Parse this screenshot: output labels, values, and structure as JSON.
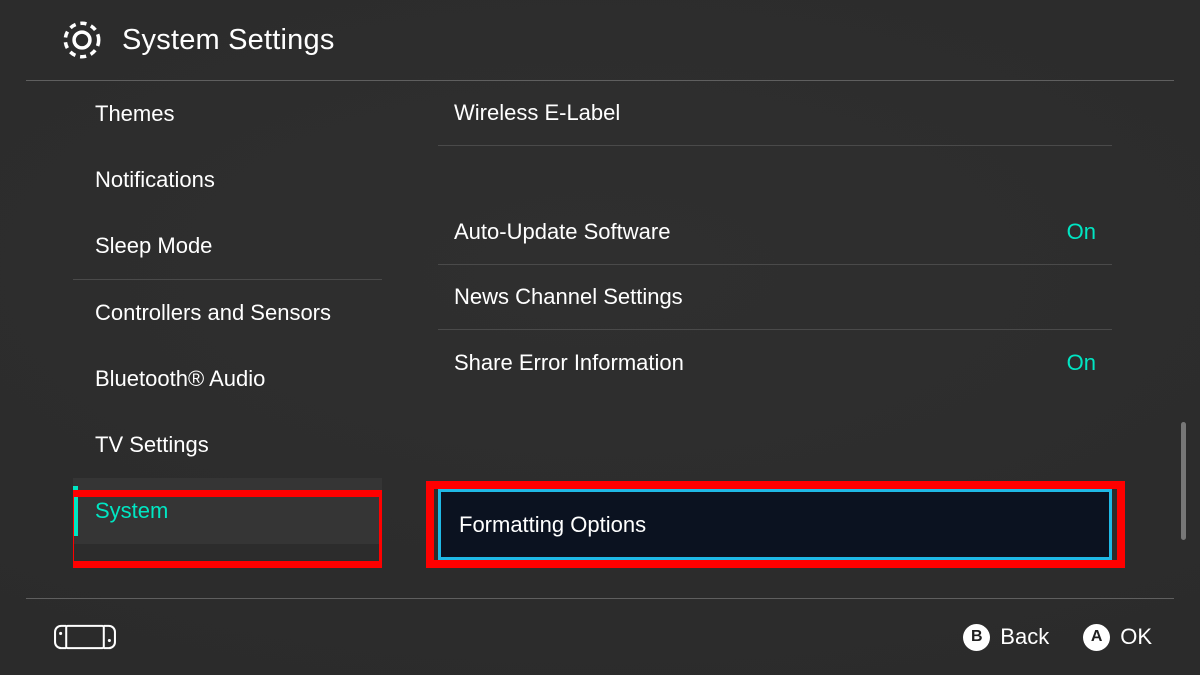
{
  "header": {
    "title": "System Settings"
  },
  "sidebar": {
    "items": [
      {
        "label": "Themes"
      },
      {
        "label": "Notifications"
      },
      {
        "label": "Sleep Mode"
      },
      {
        "label": "Controllers and Sensors"
      },
      {
        "label": "Bluetooth® Audio"
      },
      {
        "label": "TV Settings"
      },
      {
        "label": "System"
      }
    ],
    "selectedIndex": 6
  },
  "content": {
    "rows": [
      {
        "label": "Wireless E-Label",
        "value": ""
      },
      {
        "gap": true
      },
      {
        "label": "Auto-Update Software",
        "value": "On"
      },
      {
        "label": "News Channel Settings",
        "value": ""
      },
      {
        "label": "Share Error Information",
        "value": "On"
      }
    ],
    "focus": {
      "label": "Formatting Options"
    }
  },
  "footer": {
    "back": {
      "key": "B",
      "label": "Back"
    },
    "ok": {
      "key": "A",
      "label": "OK"
    }
  },
  "colors": {
    "accent": "#00e6c3",
    "focusBorder": "#1fb9e6",
    "highlightBox": "#ff0000"
  }
}
